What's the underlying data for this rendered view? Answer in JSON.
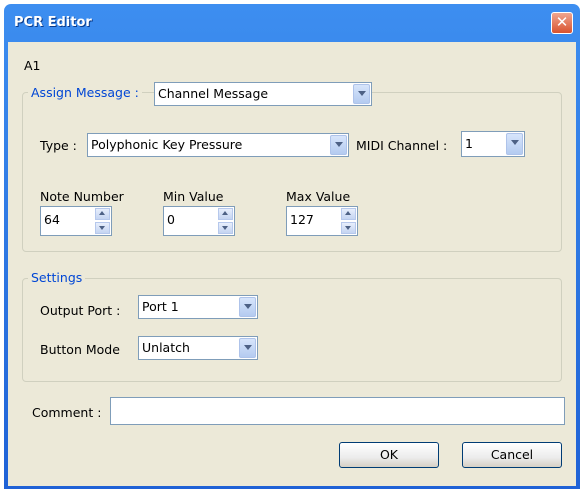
{
  "window": {
    "title": "PCR Editor",
    "close_symbol": "✕"
  },
  "header": {
    "id_label": "A1"
  },
  "assign": {
    "group_title": "Assign Message :",
    "message_value": "Channel Message",
    "type_label": "Type :",
    "type_value": "Polyphonic Key Pressure",
    "midi_label": "MIDI Channel :",
    "midi_value": "1",
    "note_label": "Note Number",
    "note_value": "64",
    "min_label": "Min Value",
    "min_value": "0",
    "max_label": "Max Value",
    "max_value": "127"
  },
  "settings": {
    "group_title": "Settings",
    "output_label": "Output Port :",
    "output_value": "Port 1",
    "mode_label": "Button Mode",
    "mode_value": "Unlatch"
  },
  "comment": {
    "label": "Comment :",
    "value": ""
  },
  "buttons": {
    "ok": "OK",
    "cancel": "Cancel"
  },
  "colors": {
    "titlebar": "#2a6fe0",
    "group_title": "#0046d5",
    "client": "#ece9d8"
  }
}
